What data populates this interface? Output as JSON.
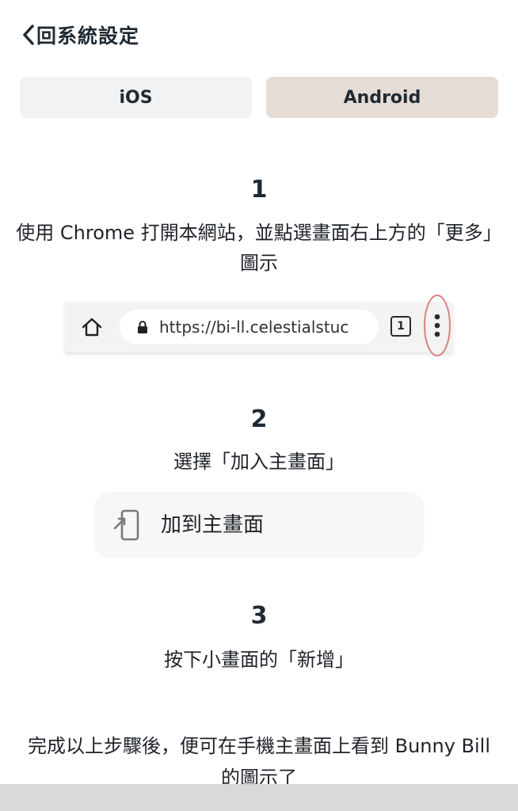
{
  "header": {
    "back_label": "回系統設定",
    "back_icon": "chevron-left-icon"
  },
  "tabs": [
    {
      "label": "iOS",
      "selected": false
    },
    {
      "label": "Android",
      "selected": true
    }
  ],
  "colors": {
    "tab_inactive_bg": "#f0f2f3",
    "tab_active_bg": "#e6dcd6",
    "highlight_circle": "#d9837f",
    "text_primary": "#1f2a33"
  },
  "steps": [
    {
      "number": "1",
      "text": "使用 Chrome 打開本網站，並點選畫面右上方的「更多」圖示"
    },
    {
      "number": "2",
      "text": "選擇「加入主畫面」"
    },
    {
      "number": "3",
      "text": "按下小畫面的「新增」"
    }
  ],
  "browser_bar": {
    "home_icon": "home-icon",
    "lock_icon": "lock-icon",
    "url": "https://bi-ll.celestialstuc",
    "tab_count": "1",
    "more_icon": "more-vertical-icon"
  },
  "add_to_home": {
    "icon": "add-to-home-icon",
    "label": "加到主畫面"
  },
  "final_note": "完成以上步驟後，便可在手機主畫面上看到 Bunny Bill 的圖示了"
}
